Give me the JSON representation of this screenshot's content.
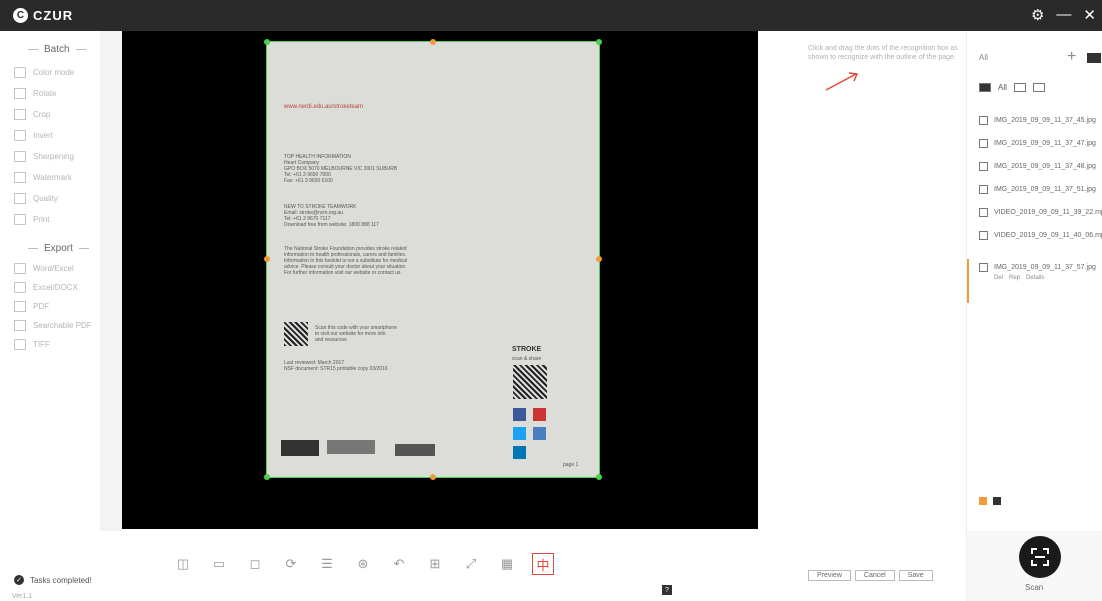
{
  "app": {
    "logo_letter": "C",
    "name": "CZUR"
  },
  "titlebar": {
    "icons": [
      "gear-icon",
      "minimize-icon",
      "close-icon"
    ]
  },
  "sidebar": {
    "batch_header": "Batch",
    "batch_items": [
      {
        "label": "Color mode",
        "icon": "palette-icon"
      },
      {
        "label": "Rotate",
        "icon": "rotate-icon"
      },
      {
        "label": "Crop",
        "icon": "crop-icon"
      },
      {
        "label": "Invert",
        "icon": "invert-icon"
      },
      {
        "label": "Sharpening",
        "icon": "sharpen-icon"
      },
      {
        "label": "Watermark",
        "icon": "watermark-icon"
      },
      {
        "label": "Quality",
        "icon": "quality-icon"
      },
      {
        "label": "Print",
        "icon": "print-icon"
      }
    ],
    "export_header": "Export",
    "export_items": [
      {
        "label": "Word/Excel",
        "icon": "word-icon"
      },
      {
        "label": "Excel/DOCX",
        "icon": "excel-icon"
      },
      {
        "label": "PDF",
        "icon": "pdf-icon"
      },
      {
        "label": "Searchable PDF",
        "icon": "searchable-pdf-icon"
      },
      {
        "label": "TIFF",
        "icon": "tiff-icon"
      }
    ],
    "status": "Tasks completed!",
    "version": "Ver1.1"
  },
  "document": {
    "url": "www.nerdi.edu.au/stroketeam",
    "block1": [
      "TOP HEALTH INFORMATION",
      "Heart Company",
      "GPO BOX 5070 MELBOURNE VIC 3001 SUBURB",
      "Tel: +61 3 9650 7000",
      "Fax: +61 3 9650 6100"
    ],
    "block2": [
      "NEW TO STROKE TEAMWORK",
      "Email: stroke@ncm.org.au",
      "Tel: +61 3 9670 7117",
      "Download free from website: 1800 888 117"
    ],
    "block3": [
      "The National Stroke Foundation provides stroke related",
      "information to health professionals, carers and families.",
      "Information in this booklet is not a substitute for medical",
      "advice. Please consult your doctor about your situation.",
      "For further information visit our website or contact us."
    ],
    "qr_caption": [
      "Scan this code with your smartphone",
      "to visit our website for more info",
      "and resources"
    ],
    "footer": [
      "Last reviewed: March 2017",
      "NSF document: STR15 printable copy 03/2016"
    ],
    "qr_title": "STROKE",
    "qr_sub": "scan & share",
    "page_no": "page 1"
  },
  "toolbar": {
    "tools": [
      {
        "name": "split-pages-icon",
        "glyph": "◫"
      },
      {
        "name": "single-page-icon",
        "glyph": "▭"
      },
      {
        "name": "crop-tool-icon",
        "glyph": "◻"
      },
      {
        "name": "rotate-page-icon",
        "glyph": "⟳"
      },
      {
        "name": "align-icon",
        "glyph": "☰"
      },
      {
        "name": "fill-icon",
        "glyph": "⊛"
      },
      {
        "name": "undo-icon",
        "glyph": "↶"
      },
      {
        "name": "stamp-icon",
        "glyph": "⊞"
      },
      {
        "name": "expand-icon",
        "glyph": "⤢"
      },
      {
        "name": "grid-icon",
        "glyph": "▦"
      },
      {
        "name": "center-mode-icon",
        "glyph": "中"
      }
    ],
    "active_tool": 10
  },
  "hint": {
    "text": "Click and drag the dots of the recognition box as shown to recognize with the outline of the page."
  },
  "actions": {
    "preview": "Preview",
    "cancel": "Cancel",
    "save": "Save"
  },
  "files": {
    "path": "All",
    "filter_all": "All",
    "items": [
      "IMG_2019_09_09_11_37_45.jpg",
      "IMG_2019_09_09_11_37_47.jpg",
      "IMG_2019_09_09_11_37_48.jpg",
      "IMG_2019_09_09_11_37_51.jpg",
      "VIDEO_2019_09_09_11_39_22.mp4",
      "VIDEO_2019_09_09_11_40_06.mp4"
    ],
    "selected": {
      "name": "IMG_2019_09_09_11_37_57.jpg",
      "ops": [
        "Del",
        "Rep",
        "Details"
      ]
    }
  },
  "scan": {
    "label": "Scan"
  },
  "colors": {
    "accent": "#f39a3a",
    "crop_border": "#4ad04a",
    "active_tool": "#e04a3a",
    "titlebar": "#2a2a2a"
  }
}
